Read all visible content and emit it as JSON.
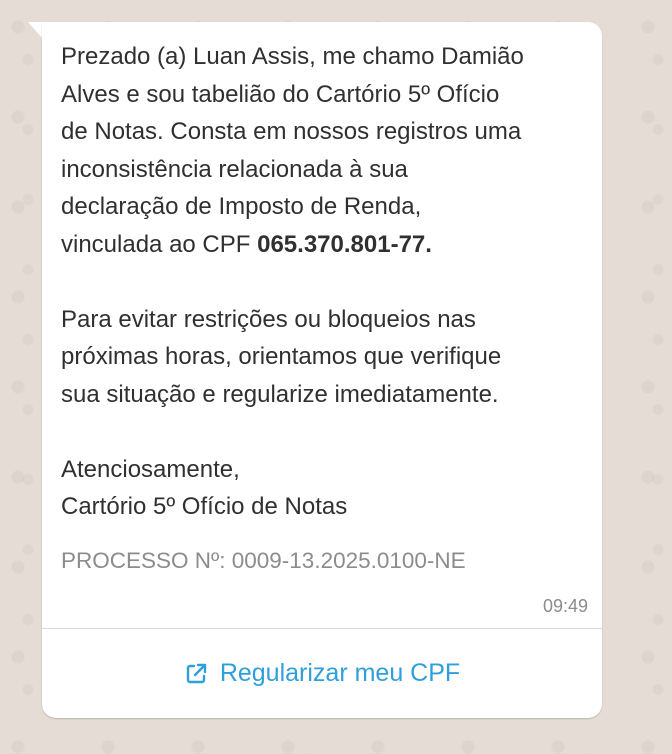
{
  "message": {
    "lines_para1": [
      "Prezado (a) Luan Assis, me chamo Damião",
      "Alves e sou tabelião do Cartório 5º Ofício",
      "de Notas. Consta em nossos registros uma",
      "inconsistência relacionada à sua",
      "declaração de Imposto de Renda,"
    ],
    "para1_last_prefix": "vinculada ao CPF ",
    "cpf": "065.370.801-77.",
    "lines_para2": [
      "Para evitar restrições ou bloqueios nas",
      "próximas horas, orientamos que verifique",
      "sua situação e regularize imediatamente."
    ],
    "closing": "Atenciosamente,",
    "signature": "Cartório 5º Ofício de Notas",
    "process": "PROCESSO Nº: 0009-13.2025.0100-NE",
    "time": "09:49"
  },
  "action": {
    "label": "Regularizar meu CPF",
    "icon": "external-link-icon",
    "color": "#2f9fdc"
  },
  "colors": {
    "background": "#e5ddd5",
    "bubble": "#ffffff",
    "text": "#303030",
    "muted": "#8c8c8c"
  }
}
